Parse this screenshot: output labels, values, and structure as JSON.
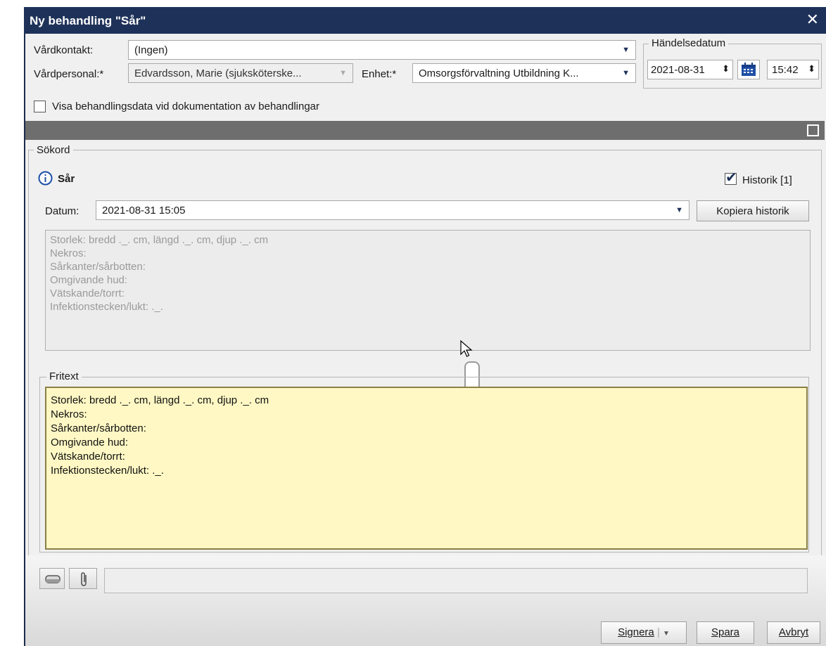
{
  "dialog": {
    "title": "Ny behandling \"Sår\"",
    "close_symbol": "✕"
  },
  "header": {
    "vardkontakt_label": "Vårdkontakt:",
    "vardkontakt_value": "(Ingen)",
    "vardpersonal_label": "Vårdpersonal:*",
    "vardpersonal_value": "Edvardsson, Marie (sjuksköterske...",
    "enhet_label": "Enhet:*",
    "enhet_value": "Omsorgsförvaltning Utbildning K...",
    "handelsedatum_title": "Händelsedatum",
    "date_value": "2021-08-31",
    "time_value": "15:42"
  },
  "options": {
    "show_treatment_data_label": "Visa behandlingsdata vid dokumentation av behandlingar",
    "show_treatment_data_checked": false
  },
  "sokord": {
    "group_title": "Sökord",
    "term": "Sår",
    "historik_label": "Historik [1]",
    "historik_checked": true,
    "datum_label": "Datum:",
    "datum_value": "2021-08-31 15:05",
    "kopiera_button": "Kopiera historik",
    "history_text": "Storlek: bredd ._. cm, längd ._. cm, djup ._. cm\nNekros:\nSårkanter/sårbotten:\nOmgivande hud:\nVätskande/torrt:\nInfektionstecken/lukt: ._."
  },
  "fritext": {
    "group_title": "Fritext",
    "text": "Storlek: bredd ._. cm, längd ._. cm, djup ._. cm\nNekros:\nSårkanter/sårbotten:\nOmgivande hud:\nVätskande/torrt:\nInfektionstecken/lukt: ._."
  },
  "footer": {
    "signera_button": "Signera",
    "spara_button": "Spara",
    "avbryt_button": "Avbryt"
  },
  "colors": {
    "titlebar": "#1e3259",
    "fritext_background": "#fff8c4",
    "section_bar": "#6e6e6e"
  },
  "icons": {
    "info": "info-icon",
    "calendar": "calendar-icon",
    "eraser": "eraser-icon",
    "attachment": "paperclip-icon"
  }
}
